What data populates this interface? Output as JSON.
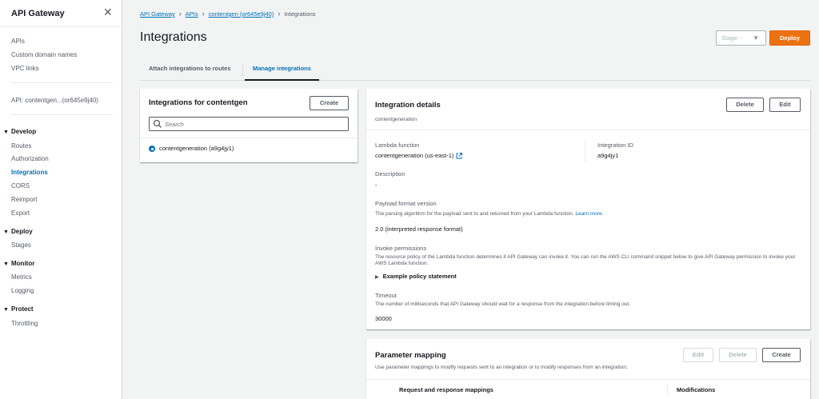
{
  "sidebar": {
    "title": "API Gateway",
    "top_links": [
      "APIs",
      "Custom domain names",
      "VPC links"
    ],
    "api_name": "API: contentgen...(or645e9j40)",
    "sections": [
      {
        "title": "Develop",
        "items": [
          "Routes",
          "Authorization",
          "Integrations",
          "CORS",
          "Reimport",
          "Export"
        ]
      },
      {
        "title": "Deploy",
        "items": [
          "Stages"
        ]
      },
      {
        "title": "Monitor",
        "items": [
          "Metrics",
          "Logging"
        ]
      },
      {
        "title": "Protect",
        "items": [
          "Throttling"
        ]
      }
    ],
    "active_item": "Integrations"
  },
  "breadcrumb": [
    "API Gateway",
    "APIs",
    "contentgen (or645e9j40)",
    "Integrations"
  ],
  "page_title": "Integrations",
  "stage_select": {
    "value": "Stage: -"
  },
  "deploy_label": "Deploy",
  "tabs": [
    {
      "label": "Attach integrations to routes",
      "active": false
    },
    {
      "label": "Manage integrations",
      "active": true
    }
  ],
  "list_panel": {
    "title": "Integrations for contentgen",
    "create_label": "Create",
    "search_placeholder": "Search",
    "items": [
      {
        "label": "contentgeneration (a9g4jy1)",
        "selected": true
      }
    ]
  },
  "details": {
    "title": "Integration details",
    "subtitle": "contentgeneration",
    "delete_label": "Delete",
    "edit_label": "Edit",
    "lambda_label": "Lambda function",
    "lambda_value": "contentgeneration (us-east-1)",
    "integration_id_label": "Integration ID",
    "integration_id_value": "a9g4jy1",
    "description_label": "Description",
    "description_value": "-",
    "payload_label": "Payload format version",
    "payload_desc": "The parsing algorithm for the payload sent to and returned from your Lambda function.",
    "payload_learn_more": "Learn more.",
    "payload_value": "2.0 (interpreted response format)",
    "invoke_label": "Invoke permissions",
    "invoke_desc": "The resource policy of the Lambda function determines if API Gateway can invoke it. You can run the AWS CLI command snippet below to give API Gateway permission to invoke your AWS Lambda function.",
    "policy_label": "Example policy statement",
    "timeout_label": "Timeout",
    "timeout_desc": "The number of milliseconds that API Gateway should wait for a response from the integration before timing out.",
    "timeout_value": "30000"
  },
  "param_mapping": {
    "title": "Parameter mapping",
    "desc": "Use parameter mappings to modify requests sent to an integration or to modify responses from an integration.",
    "edit_label": "Edit",
    "delete_label": "Delete",
    "create_label": "Create",
    "columns": [
      "Request and response mappings",
      "Modifications"
    ]
  },
  "colors": {
    "accent": "#0073bb",
    "primary_button": "#ec7211"
  }
}
